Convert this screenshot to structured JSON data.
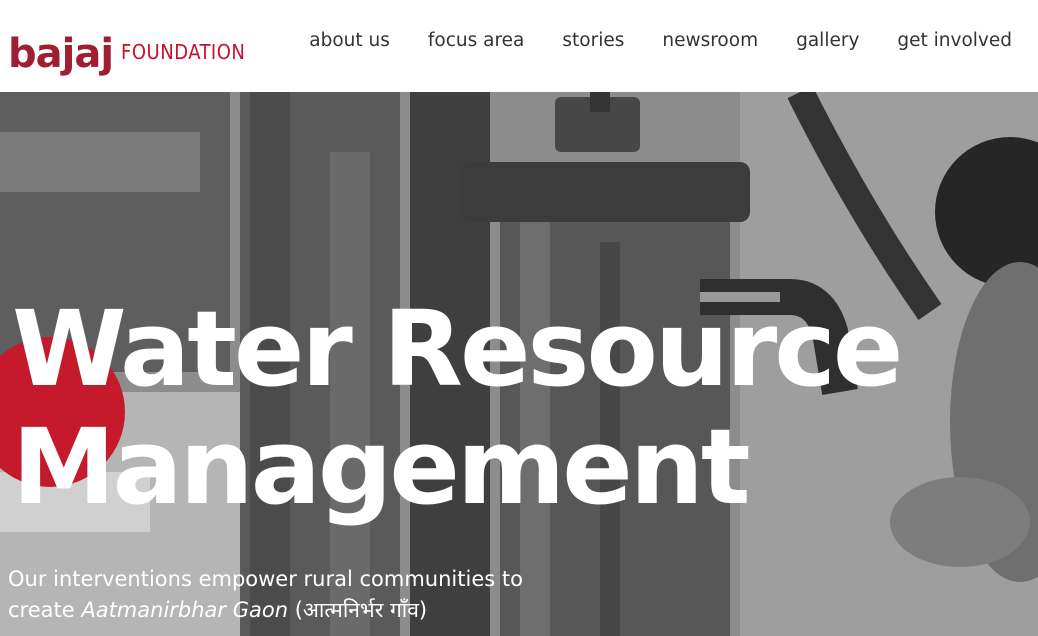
{
  "logo": {
    "bajaj": "bajaj",
    "foundation": "FOUNDATION"
  },
  "nav": {
    "items": [
      {
        "label": "about us"
      },
      {
        "label": "focus area"
      },
      {
        "label": "stories"
      },
      {
        "label": "newsroom"
      },
      {
        "label": "gallery"
      },
      {
        "label": "get involved"
      }
    ]
  },
  "hero": {
    "title_line1": "Water Resource",
    "title_line2": "Management",
    "subtitle_prefix": "Our interventions empower rural communities to create ",
    "subtitle_emphasis": "Aatmanirbhar Gaon",
    "subtitle_suffix": " (आत्मनिर्भर गाँव)"
  },
  "colors": {
    "brand": "#a01e33",
    "accent": "#c51a2b",
    "nav_text": "#333333"
  }
}
